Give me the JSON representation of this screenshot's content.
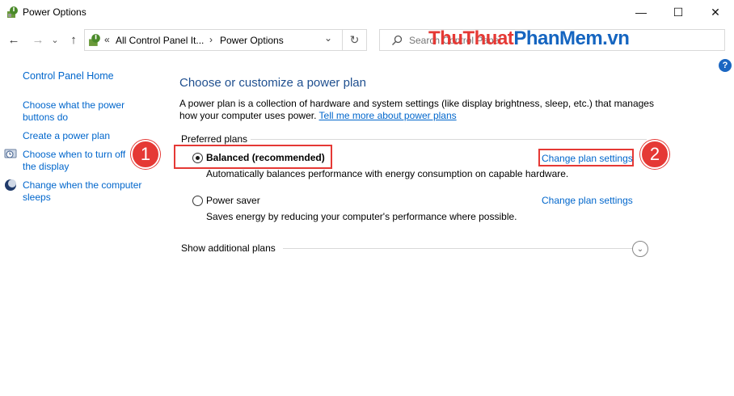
{
  "window": {
    "title": "Power Options",
    "minimize": "—",
    "maximize": "☐",
    "close": "✕"
  },
  "nav": {
    "back": "←",
    "forward": "→",
    "recent": "⌄",
    "up": "↑",
    "chevrons": "«",
    "breadcrumb_1": "All Control Panel It...",
    "separator": "›",
    "breadcrumb_2": "Power Options",
    "dropdown": "⌄",
    "refresh": "↻"
  },
  "search": {
    "placeholder": "Search Control Panel"
  },
  "watermark": {
    "part1": "ThuThuat",
    "part2": "PhanMem",
    "part3": ".vn"
  },
  "help": "?",
  "sidebar": {
    "home": "Control Panel Home",
    "items": [
      "Choose what the power buttons do",
      "Create a power plan",
      "Choose when to turn off the display",
      "Change when the computer sleeps"
    ]
  },
  "main": {
    "heading": "Choose or customize a power plan",
    "description": "A power plan is a collection of hardware and system settings (like display brightness, sleep, etc.) that manages how your computer uses power.",
    "learn_more": "Tell me more about power plans",
    "preferred_label": "Preferred plans",
    "plans": [
      {
        "name": "Balanced (recommended)",
        "description": "Automatically balances performance with energy consumption on capable hardware.",
        "link": "Change plan settings",
        "selected": true
      },
      {
        "name": "Power saver",
        "description": "Saves energy by reducing your computer's performance where possible.",
        "link": "Change plan settings",
        "selected": false
      }
    ],
    "additional": "Show additional plans",
    "expand": "⌄"
  },
  "callouts": [
    "1",
    "2"
  ],
  "colors": {
    "link": "#0066cc",
    "heading": "#1f4f8f",
    "callout": "#e53935",
    "watermark_red": "#e53935",
    "watermark_blue": "#1565c0"
  }
}
